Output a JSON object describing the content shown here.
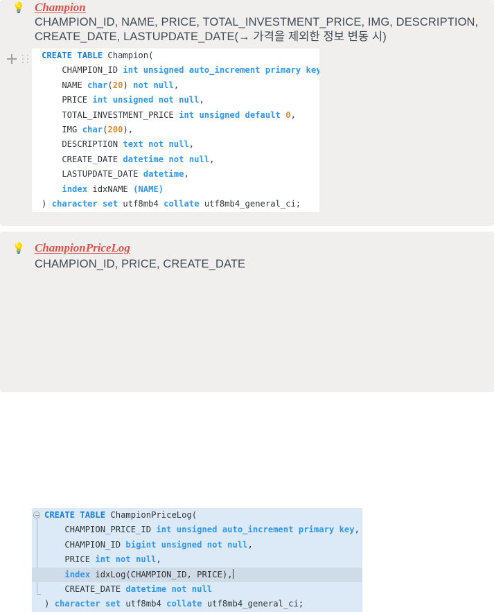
{
  "page": {
    "background": "#ffffff",
    "panel_background": "#f0efed"
  },
  "colors": {
    "title": "#d8534c",
    "note_text": "#3f4a55",
    "keyword": "#1d7fd4",
    "type": "#2f97e8",
    "number": "#e08a2e",
    "identifier": "#2f3438",
    "code_bg_1": "#ffffff",
    "code_bg_2": "#dceaf7",
    "current_line": "#cfdbe7"
  },
  "sections": [
    {
      "bulb_icon": "💡",
      "title": "Champion",
      "note_lines": [
        "CHAMPION_ID, NAME, PRICE, TOTAL_INVESTMENT_PRICE, IMG, DESCRIPTION,",
        "CREATE_DATE, LASTUPDATE_DATE(→ 가격을 제외한 정보 변동 시)"
      ],
      "gutter": {
        "add_icon": "plus-icon",
        "drag_icon": "drag-handle-icon"
      },
      "code_lines": [
        [
          {
            "t": "CREATE TABLE ",
            "c": "kw"
          },
          {
            "t": "Champion(",
            "c": "ident"
          }
        ],
        [
          {
            "t": "    CHAMPION_ID ",
            "c": "ident"
          },
          {
            "t": "int unsigned auto_increment primary key",
            "c": "type"
          },
          {
            "t": ",",
            "c": "punct"
          }
        ],
        [
          {
            "t": "    NAME ",
            "c": "ident"
          },
          {
            "t": "char",
            "c": "type"
          },
          {
            "t": "(",
            "c": "punct"
          },
          {
            "t": "20",
            "c": "num"
          },
          {
            "t": ") ",
            "c": "punct"
          },
          {
            "t": "not null",
            "c": "type"
          },
          {
            "t": ",",
            "c": "punct"
          }
        ],
        [
          {
            "t": "    PRICE ",
            "c": "ident"
          },
          {
            "t": "int unsigned not null",
            "c": "type"
          },
          {
            "t": ",",
            "c": "punct"
          }
        ],
        [
          {
            "t": "    TOTAL_INVESTMENT_PRICE ",
            "c": "ident"
          },
          {
            "t": "int unsigned default ",
            "c": "type"
          },
          {
            "t": "0",
            "c": "num"
          },
          {
            "t": ",",
            "c": "punct"
          }
        ],
        [
          {
            "t": "    IMG ",
            "c": "ident"
          },
          {
            "t": "char",
            "c": "type"
          },
          {
            "t": "(",
            "c": "punct"
          },
          {
            "t": "200",
            "c": "num"
          },
          {
            "t": "),",
            "c": "punct"
          }
        ],
        [
          {
            "t": "    DESCRIPTION ",
            "c": "ident"
          },
          {
            "t": "text not null",
            "c": "type"
          },
          {
            "t": ",",
            "c": "punct"
          }
        ],
        [
          {
            "t": "    CREATE_DATE ",
            "c": "ident"
          },
          {
            "t": "datetime not null",
            "c": "type"
          },
          {
            "t": ",",
            "c": "punct"
          }
        ],
        [
          {
            "t": "    LASTUPDATE_DATE ",
            "c": "ident"
          },
          {
            "t": "datetime",
            "c": "type"
          },
          {
            "t": ",",
            "c": "punct"
          }
        ],
        [
          {
            "t": "    ",
            "c": "ident"
          },
          {
            "t": "index",
            "c": "type"
          },
          {
            "t": " idxNAME ",
            "c": "ident"
          },
          {
            "t": "(",
            "c": "type"
          },
          {
            "t": "NAME",
            "c": "type"
          },
          {
            "t": ")",
            "c": "type"
          }
        ],
        [
          {
            "t": ") ",
            "c": "ident"
          },
          {
            "t": "character set ",
            "c": "type"
          },
          {
            "t": "utf8mb4 ",
            "c": "ident"
          },
          {
            "t": "collate ",
            "c": "type"
          },
          {
            "t": "utf8mb4_general_ci;",
            "c": "ident"
          }
        ]
      ]
    },
    {
      "bulb_icon": "💡",
      "title": "ChampionPriceLog",
      "note_lines": [
        "CHAMPION_ID, PRICE, CREATE_DATE"
      ],
      "fold_marker": "collapse-fold-icon",
      "current_line_index": 4,
      "code_lines": [
        [
          {
            "t": "CREATE TABLE ",
            "c": "kw"
          },
          {
            "t": "ChampionPriceLog(",
            "c": "ident"
          }
        ],
        [
          {
            "t": "    CHAMPION_PRICE_ID ",
            "c": "ident"
          },
          {
            "t": "int unsigned auto_increment primary key",
            "c": "type"
          },
          {
            "t": ",",
            "c": "punct"
          }
        ],
        [
          {
            "t": "    CHAMPION_ID ",
            "c": "ident"
          },
          {
            "t": "bigint unsigned not null",
            "c": "type"
          },
          {
            "t": ",",
            "c": "punct"
          }
        ],
        [
          {
            "t": "    PRICE ",
            "c": "ident"
          },
          {
            "t": "int not null",
            "c": "type"
          },
          {
            "t": ",",
            "c": "punct"
          }
        ],
        [
          {
            "t": "    ",
            "c": "ident"
          },
          {
            "t": "index",
            "c": "type"
          },
          {
            "t": " idxLog(CHAMPION_ID, PRICE),",
            "c": "ident"
          }
        ],
        [
          {
            "t": "    CREATE_DATE ",
            "c": "ident"
          },
          {
            "t": "datetime not null",
            "c": "type"
          }
        ],
        [
          {
            "t": ") ",
            "c": "ident"
          },
          {
            "t": "character set ",
            "c": "type"
          },
          {
            "t": "utf8mb4 ",
            "c": "ident"
          },
          {
            "t": "collate ",
            "c": "type"
          },
          {
            "t": "utf8mb4_general_ci;",
            "c": "ident"
          }
        ]
      ]
    }
  ]
}
